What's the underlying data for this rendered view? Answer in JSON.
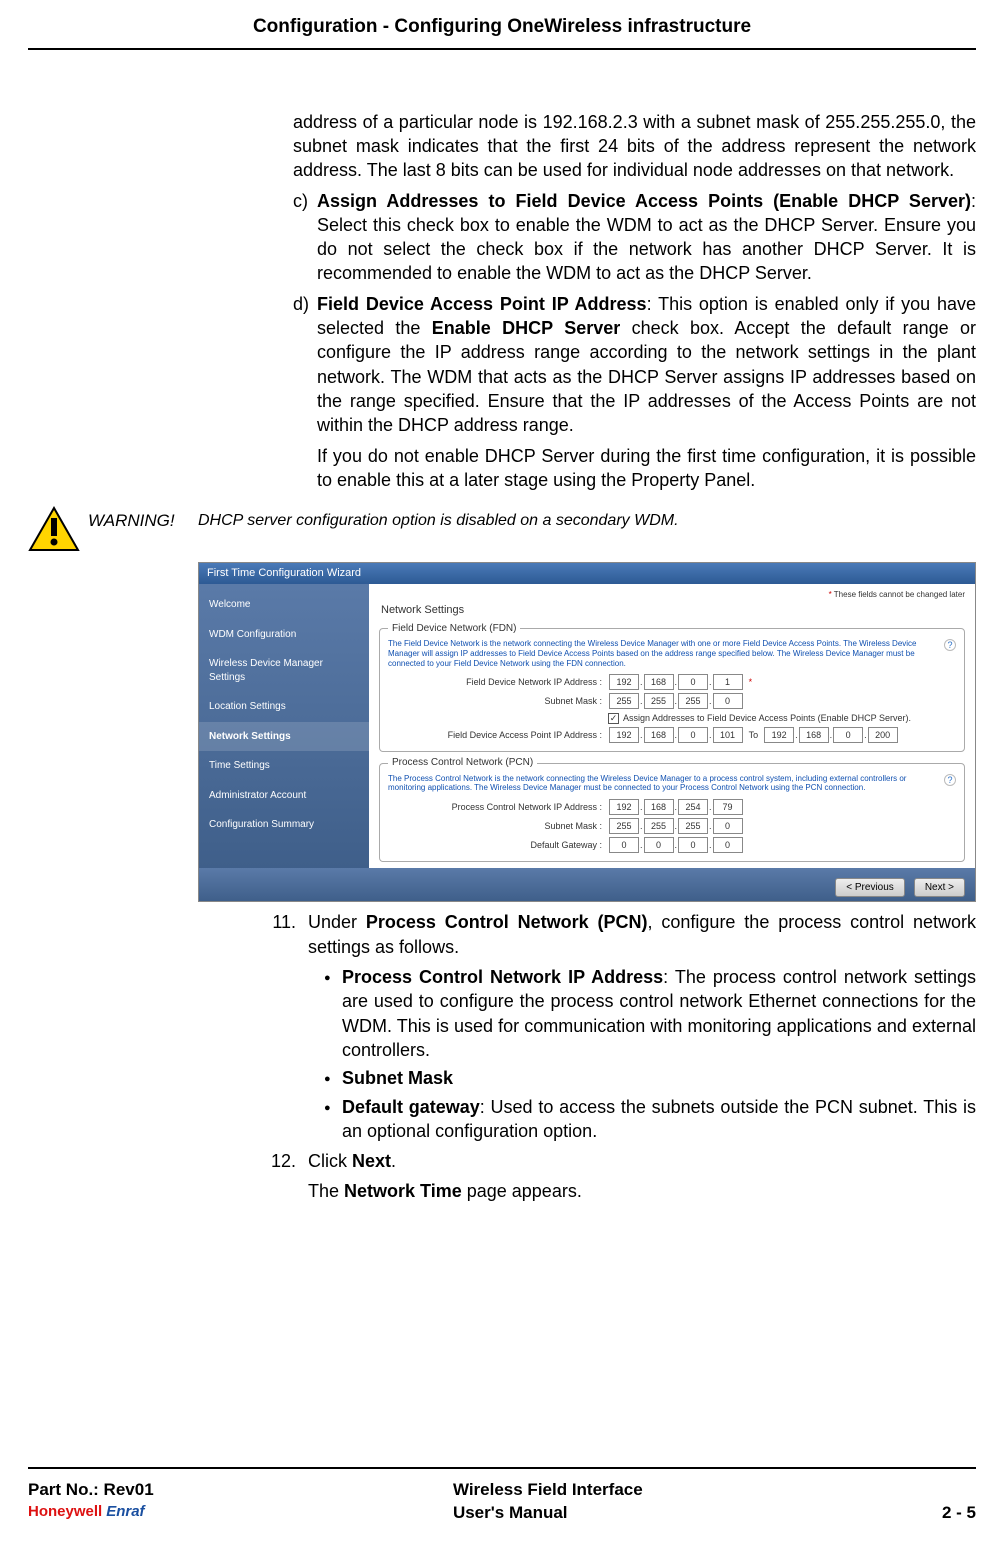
{
  "header": "Configuration - Configuring OneWireless infrastructure",
  "para_intro": "address of a particular node is 192.168.2.3 with a subnet mask of 255.255.255.0, the subnet mask indicates that the first 24 bits of the address represent the network address. The last 8 bits can be used for individual node addresses on that network.",
  "item_c": {
    "marker": "c)",
    "title": "Assign Addresses to Field Device Access Points (Enable DHCP Server)",
    "text": ": Select this check box to enable the WDM to act as the DHCP Server. Ensure you do not select the check box if the network has another DHCP Server. It is recommended to enable the WDM to act as the DHCP Server."
  },
  "item_d": {
    "marker": "d)",
    "title": "Field Device Access Point IP Address",
    "text": ": This option is enabled only if you have selected the ",
    "bold2": "Enable DHCP Server",
    "text2": " check box. Accept the default range or configure the IP address range according to the network settings in the plant network. The WDM that acts as the DHCP Server assigns IP addresses based on the range specified. Ensure that the IP addresses of the Access Points are not within the DHCP address range.",
    "sub": "If you do not enable DHCP Server during the first time configuration, it is possible to enable this at a later stage using the Property Panel."
  },
  "warning": {
    "label": "WARNING!",
    "text": "DHCP server configuration option is disabled on a secondary WDM."
  },
  "wizard": {
    "title": "First Time Configuration Wizard",
    "nav": [
      "Welcome",
      "WDM Configuration",
      "Wireless Device Manager Settings",
      "Location Settings",
      "Network Settings",
      "Time Settings",
      "Administrator Account",
      "Configuration Summary"
    ],
    "active_idx": 4,
    "req_note": "These fields cannot be changed later",
    "panel": "Network Settings",
    "fdn": {
      "legend": "Field Device Network (FDN)",
      "desc": "The Field Device Network is the network connecting the Wireless Device Manager with one or more Field Device Access Points. The Wireless Device Manager will assign IP addresses to Field Device Access Points based on the address range specified below. The Wireless Device Manager must be connected to your Field Device Network using the FDN connection.",
      "rows": {
        "ip_label": "Field Device Network IP Address :",
        "ip": [
          "192",
          "168",
          "0",
          "1"
        ],
        "mask_label": "Subnet Mask :",
        "mask": [
          "255",
          "255",
          "255",
          "0"
        ],
        "cb_label": "Assign Addresses to Field Device Access Points (Enable DHCP Server).",
        "range_label": "Field Device Access Point IP Address :",
        "range_from": [
          "192",
          "168",
          "0",
          "101"
        ],
        "to_label": "To",
        "range_to": [
          "192",
          "168",
          "0",
          "200"
        ]
      }
    },
    "pcn": {
      "legend": "Process Control Network (PCN)",
      "desc": "The Process Control Network is the network connecting the Wireless Device Manager to a process control system, including external controllers or monitoring applications. The Wireless Device Manager must be connected to your Process Control Network using the PCN connection.",
      "rows": {
        "ip_label": "Process Control Network IP Address :",
        "ip": [
          "192",
          "168",
          "254",
          "79"
        ],
        "mask_label": "Subnet Mask :",
        "mask": [
          "255",
          "255",
          "255",
          "0"
        ],
        "gw_label": "Default Gateway :",
        "gw": [
          "0",
          "0",
          "0",
          "0"
        ]
      }
    },
    "btn_prev": "< Previous",
    "btn_next": "Next >"
  },
  "step11": {
    "num": "11.",
    "intro_a": "Under ",
    "intro_b": "Process Control Network (PCN)",
    "intro_c": ", configure the process control network settings as follows.",
    "bullets": [
      {
        "title": "Process Control Network IP Address",
        "text": ": The process control network settings are used to configure the process control network Ethernet connections for the WDM. This is used for communication with monitoring applications and external controllers."
      },
      {
        "title": "Subnet Mask",
        "text": ""
      },
      {
        "title": "Default gateway",
        "text": ": Used to access the subnets outside the PCN subnet. This is an optional configuration option."
      }
    ]
  },
  "step12": {
    "num": "12.",
    "text_a": "Click ",
    "text_b": "Next",
    "text_c": ".",
    "sub_a": "The ",
    "sub_b": "Network Time",
    "sub_c": " page appears."
  },
  "footer": {
    "part": "Part No.: Rev01",
    "brand1": "Honeywell",
    "brand2": "Enraf",
    "mid1": "Wireless Field Interface",
    "mid2": "User's Manual",
    "page": "2 - 5"
  }
}
